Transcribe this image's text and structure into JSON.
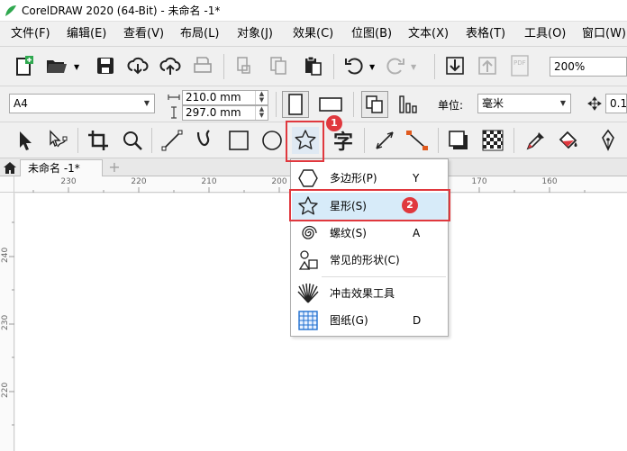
{
  "window": {
    "title": "CorelDRAW 2020 (64-Bit) - 未命名 -1*"
  },
  "menu": [
    {
      "label": "文件(F)"
    },
    {
      "label": "编辑(E)"
    },
    {
      "label": "查看(V)"
    },
    {
      "label": "布局(L)"
    },
    {
      "label": "对象(J)"
    },
    {
      "label": "效果(C)"
    },
    {
      "label": "位图(B)"
    },
    {
      "label": "文本(X)"
    },
    {
      "label": "表格(T)"
    },
    {
      "label": "工具(O)"
    },
    {
      "label": "窗口(W)"
    }
  ],
  "toolbar": {
    "zoom": "200%"
  },
  "property_bar": {
    "page_size": "A4",
    "width": "210.0 mm",
    "height": "297.0 mm",
    "units_label": "单位:",
    "units": "毫米",
    "nudge": "0.1"
  },
  "tabs": {
    "document": "未命名 -1*",
    "add": "+"
  },
  "ruler": {
    "h_labels": [
      "230",
      "220",
      "210",
      "200",
      "170",
      "160"
    ],
    "v_labels": [
      "240",
      "230",
      "220"
    ]
  },
  "flyout": {
    "items": [
      {
        "label": "多边形(P)",
        "key": "Y",
        "icon": "polygon-icon"
      },
      {
        "label": "星形(S)",
        "key": "",
        "icon": "star-icon"
      },
      {
        "label": "螺纹(S)",
        "key": "A",
        "icon": "spiral-icon"
      },
      {
        "label": "常见的形状(C)",
        "key": "",
        "icon": "common-shapes-icon"
      },
      {
        "label": "冲击效果工具",
        "key": "",
        "icon": "impact-effect-icon"
      },
      {
        "label": "图纸(G)",
        "key": "D",
        "icon": "graph-paper-icon"
      }
    ]
  },
  "annotations": {
    "badge1": "1",
    "badge2": "2"
  },
  "colors": {
    "annotation_red": "#e0383e",
    "highlight": "#d7ebf9",
    "logo_green": "#2fa84f"
  }
}
